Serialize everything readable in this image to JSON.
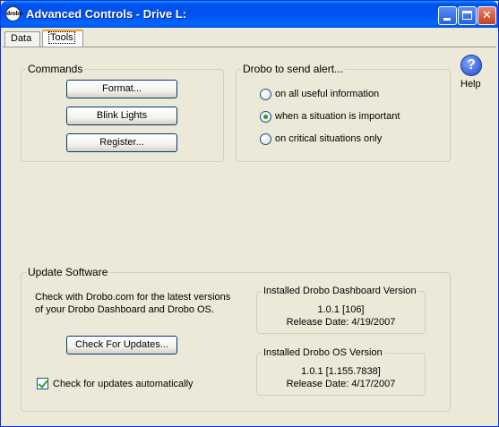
{
  "window": {
    "title": "Advanced Controls - Drive L:",
    "app_icon_text": "drobo",
    "min_glyph": "",
    "max_glyph": "",
    "close_glyph": "✕"
  },
  "tabs": [
    {
      "label": "Data",
      "selected": false
    },
    {
      "label": "Tools",
      "selected": true
    }
  ],
  "commands": {
    "legend": "Commands",
    "format_label": "Format...",
    "blink_label": "Blink Lights",
    "register_label": "Register..."
  },
  "alerts": {
    "legend": "Drobo to send alert...",
    "options": [
      {
        "label": "on all useful information",
        "checked": false
      },
      {
        "label": "when a situation is important",
        "checked": true
      },
      {
        "label": "on critical situations only",
        "checked": false
      }
    ]
  },
  "help": {
    "icon": "?",
    "label": "Help"
  },
  "update": {
    "legend": "Update Software",
    "description_line1": "Check with Drobo.com for the latest versions",
    "description_line2": "of your Drobo Dashboard and Drobo OS.",
    "check_button": "Check For Updates...",
    "auto_label": "Check for updates automatically",
    "auto_checked": true,
    "dashboard": {
      "legend": "Installed Drobo Dashboard Version",
      "version": "1.0.1  [106]",
      "release": "Release Date: 4/19/2007"
    },
    "os": {
      "legend": "Installed Drobo OS Version",
      "version": "1.0.1 [1.155.7838]",
      "release": "Release Date: 4/17/2007"
    }
  },
  "colors": {
    "titlebar": "#0054e3",
    "window_bg": "#ece9d8",
    "radio_dot": "#21a121",
    "tab_highlight": "#ff9f38"
  }
}
